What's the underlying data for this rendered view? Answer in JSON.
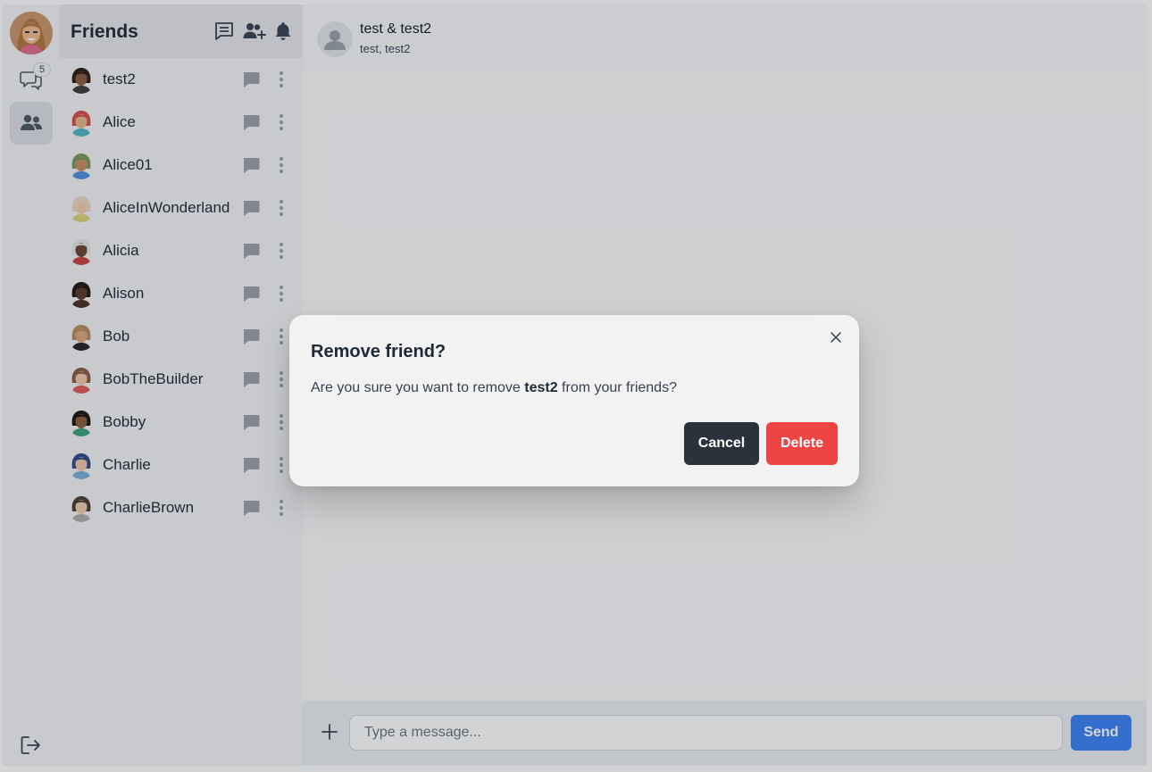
{
  "rail": {
    "user_avatar": "user-avatar",
    "chats_badge": "5",
    "icons": [
      "chats-icon",
      "friends-icon",
      "logout-icon"
    ]
  },
  "friends": {
    "title": "Friends",
    "header_icons": [
      "new-chat-icon",
      "add-friend-icon",
      "bell-icon"
    ],
    "items": [
      {
        "name": "test2",
        "skin": "#8a5a3c",
        "hair": "#2b1d14",
        "shirt": "#3b3b3b"
      },
      {
        "name": "Alice",
        "skin": "#e8b58c",
        "hair": "#d94b4b",
        "shirt": "#4db6c4"
      },
      {
        "name": "Alice01",
        "skin": "#c98e63",
        "hair": "#7a9a5a",
        "shirt": "#4a90d9"
      },
      {
        "name": "AliceInWonderland",
        "skin": "#f0cfae",
        "hair": "#e8d9c4",
        "shirt": "#d9d47a"
      },
      {
        "name": "Alicia",
        "skin": "#6b4430",
        "hair": "#e6e6e6",
        "shirt": "#c94040"
      },
      {
        "name": "Alison",
        "skin": "#5a3a28",
        "hair": "#1f1612",
        "shirt": "#4a2f25"
      },
      {
        "name": "Bob",
        "skin": "#d9a77a",
        "hair": "#b88a5a",
        "shirt": "#222222"
      },
      {
        "name": "BobTheBuilder",
        "skin": "#f0c8a8",
        "hair": "#8a5a40",
        "shirt": "#e05a5a"
      },
      {
        "name": "Bobby",
        "skin": "#8a5a3c",
        "hair": "#1a1410",
        "shirt": "#3aa37a"
      },
      {
        "name": "Charlie",
        "skin": "#f0c8a8",
        "hair": "#2c4a8a",
        "shirt": "#7ab0d9"
      },
      {
        "name": "CharlieBrown",
        "skin": "#f0cfae",
        "hair": "#4a3a30",
        "shirt": "#b0b0b0"
      }
    ]
  },
  "conversation": {
    "title": "test & test2",
    "participants": "test, test2"
  },
  "composer": {
    "placeholder": "Type a message...",
    "send_label": "Send"
  },
  "modal": {
    "title": "Remove friend?",
    "text_before": "Are you sure you want to remove ",
    "friend_name": "test2",
    "text_after": " from your friends?",
    "cancel_label": "Cancel",
    "delete_label": "Delete"
  },
  "colors": {
    "primary": "#3b82f6",
    "danger": "#ef4444",
    "neutral_dark": "#2a323c",
    "overlay": "rgba(28,33,45,0.20)"
  }
}
